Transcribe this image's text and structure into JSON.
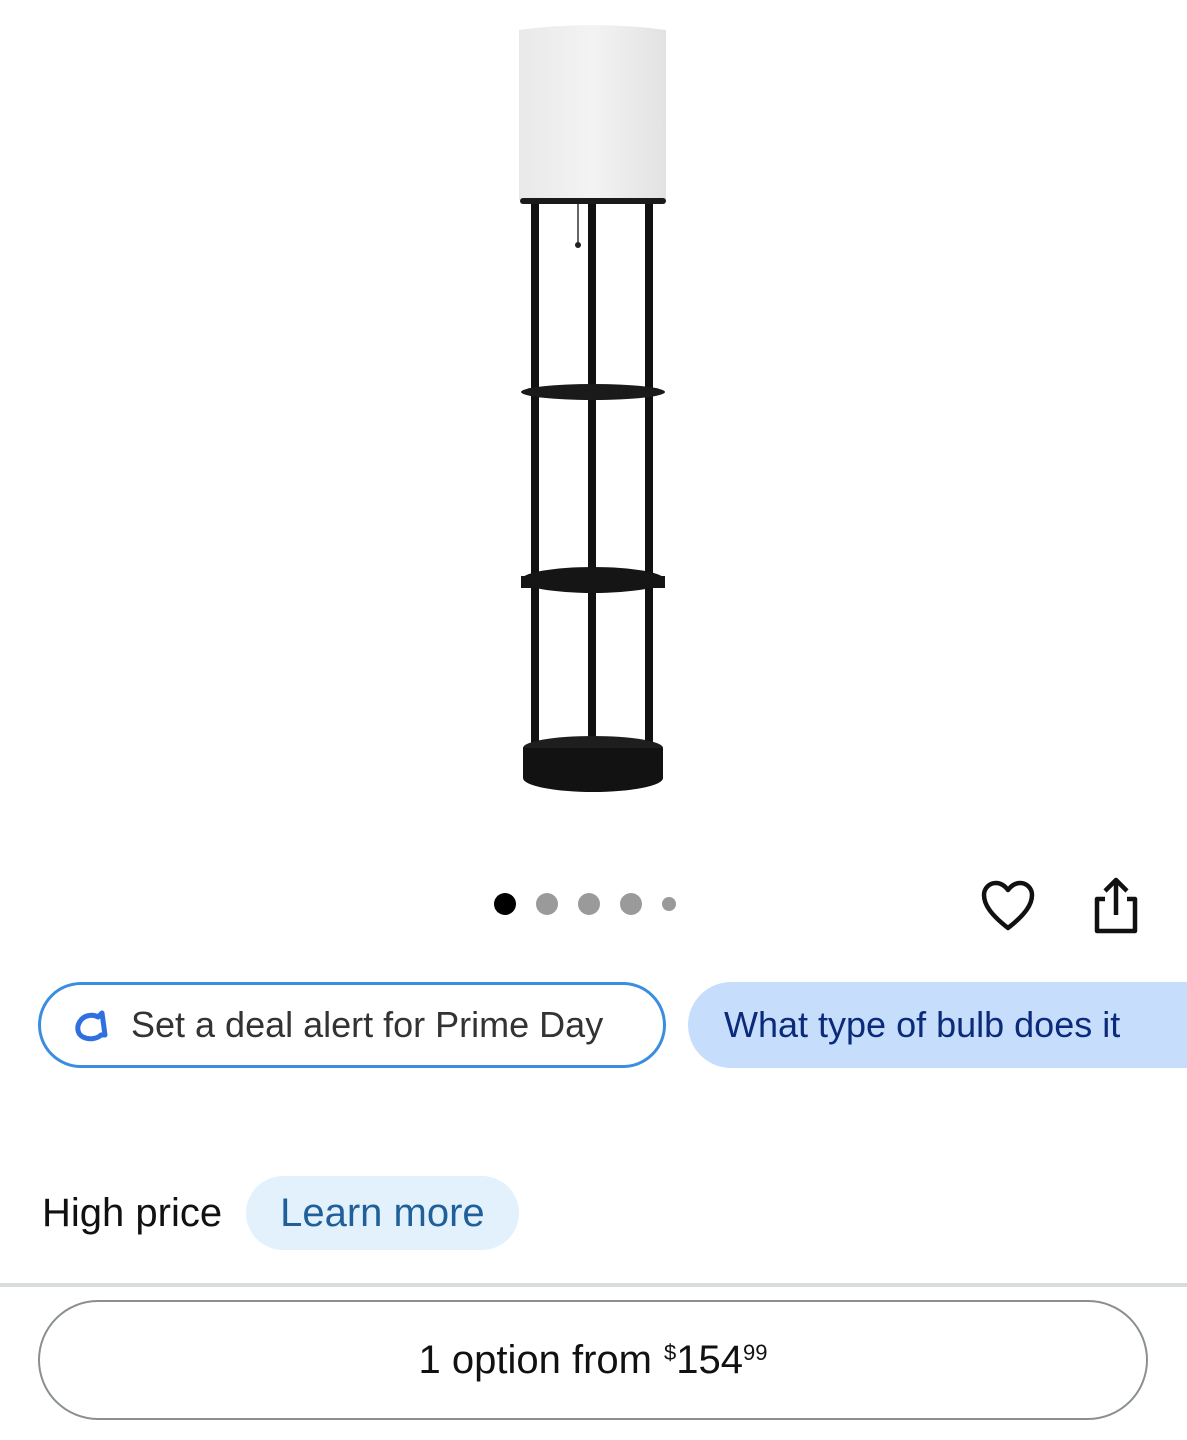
{
  "gallery": {
    "image_alt": "Floor lamp with shelves",
    "dot_count": 5,
    "active_dot_index": 0
  },
  "actions": {
    "wishlist_icon": "heart-icon",
    "share_icon": "share-icon"
  },
  "chips": {
    "deal_alert_label": "Set a deal alert for Prime Day",
    "deal_alert_icon": "alexa-icon",
    "question_label": "What type of bulb does it"
  },
  "price_status": {
    "label": "High price",
    "learn_more_label": "Learn more"
  },
  "options_button": {
    "prefix": "1 option from",
    "currency_symbol": "$",
    "price_whole": "154",
    "price_fraction": "99"
  },
  "colors": {
    "chip_alert_border": "#3b8de0",
    "chip_question_bg": "#c6defc",
    "learn_more_bg": "#e3f1fc",
    "link_text": "#1f5f9a"
  }
}
